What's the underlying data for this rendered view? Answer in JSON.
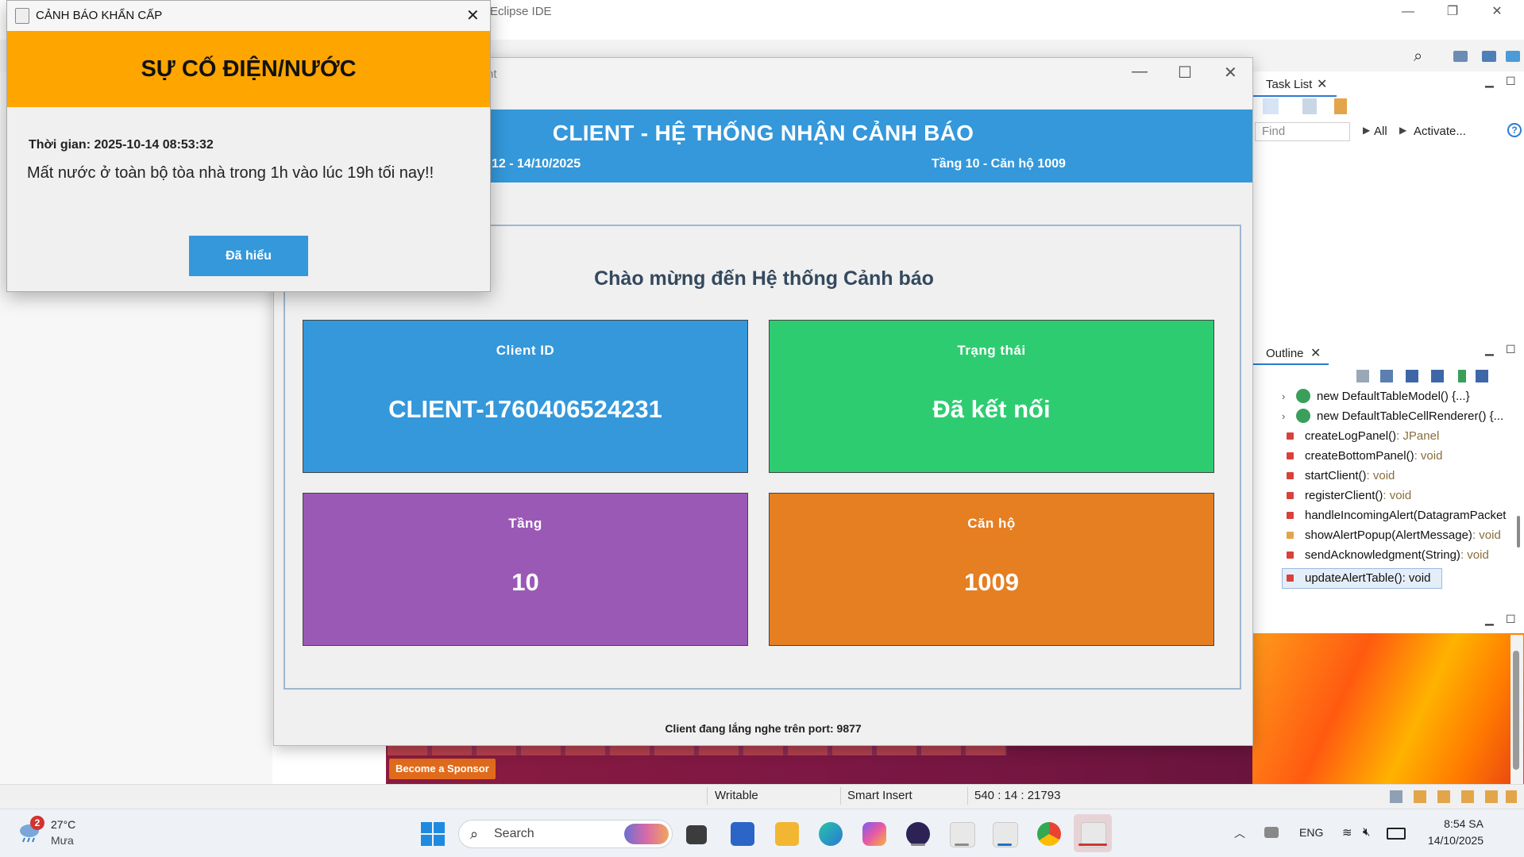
{
  "eclipse": {
    "title": "Eclipse IDE",
    "task_list_tab": "Task List",
    "find_placeholder": "Find",
    "filter_all": "All",
    "activate_label": "Activate...",
    "outline_tab": "Outline",
    "outline_items": [
      {
        "name": "new DefaultTableModel() {...}",
        "ret": ""
      },
      {
        "name": "new DefaultTableCellRenderer() {...",
        "ret": ""
      },
      {
        "name": "createLogPanel()",
        "ret": " : JPanel"
      },
      {
        "name": "createBottomPanel()",
        "ret": " : void"
      },
      {
        "name": "startClient()",
        "ret": " : void"
      },
      {
        "name": "registerClient()",
        "ret": " : void"
      },
      {
        "name": "handleIncomingAlert(DatagramPacket",
        "ret": ""
      },
      {
        "name": "showAlertPopup(AlertMessage)",
        "ret": " : void"
      },
      {
        "name": "sendAcknowledgment(String)",
        "ret": " : void"
      },
      {
        "name": "updateAlertTable()",
        "ret": " : void"
      }
    ],
    "sponsor_button": "Become a Sponsor",
    "status": {
      "writable": "Writable",
      "insert_mode": "Smart Insert",
      "position": "540 : 14 : 21793"
    }
  },
  "client": {
    "title_fragment": "nt",
    "header_title": "CLIENT - HỆ THỐNG NHẬN CẢNH BÁO",
    "header_date": "12 - 14/10/2025",
    "header_location": "Tầng 10 - Căn hộ 1009",
    "welcome": "Chào mừng đến Hệ thống Cảnh báo",
    "cards": [
      {
        "label": "Client ID",
        "value": "CLIENT-1760406524231",
        "color": "#3498db"
      },
      {
        "label": "Trạng thái",
        "value": "Đã kết nối",
        "color": "#2ecc71"
      },
      {
        "label": "Tầng",
        "value": "10",
        "color": "#9b59b6"
      },
      {
        "label": "Căn hộ",
        "value": "1009",
        "color": "#e67e22"
      }
    ],
    "footer": "Client đang lắng nghe trên port: 9877"
  },
  "alert": {
    "title": "CẢNH BÁO KHẨN CẤP",
    "banner": "SỰ CỐ ĐIỆN/NƯỚC",
    "banner_color": "#ffa500",
    "time": "Thời gian: 2025-10-14 08:53:32",
    "message": "Mất nước ở toàn bộ tòa nhà trong 1h vào lúc 19h tối nay!!",
    "ok_button": "Đã hiểu"
  },
  "taskbar": {
    "weather_badge": "2",
    "weather_temp": "27°C",
    "weather_desc": "Mưa",
    "search": "Search",
    "language": "ENG",
    "time": "8:54 SA",
    "date": "14/10/2025"
  }
}
